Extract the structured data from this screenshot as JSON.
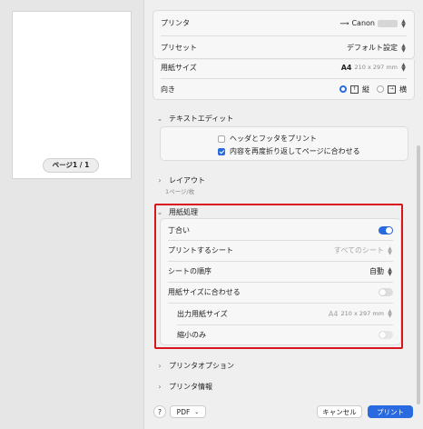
{
  "preview": {
    "page_indicator": "ページ1 / 1"
  },
  "printer": {
    "label": "プリンタ",
    "value": "Canon"
  },
  "preset": {
    "label": "プリセット",
    "value": "デフォルト設定"
  },
  "paper_size": {
    "label": "用紙サイズ",
    "value": "A4",
    "dims": "210 x 297 mm"
  },
  "orientation": {
    "label": "向き",
    "portrait": "縦",
    "landscape": "横",
    "selected": "portrait"
  },
  "textedit": {
    "title": "テキストエディット",
    "header_footer": {
      "label": "ヘッダとフッタをプリント",
      "checked": false
    },
    "rewrap": {
      "label": "内容を再度折り返してページに合わせる",
      "checked": true
    }
  },
  "layout": {
    "title": "レイアウト",
    "subtitle": "1ページ/枚"
  },
  "paper_handling": {
    "title": "用紙処理",
    "collate": {
      "label": "丁合い",
      "on": true
    },
    "pages_to_print": {
      "label": "プリントするシート",
      "value": "すべてのシート"
    },
    "page_order": {
      "label": "シートの順序",
      "value": "自動"
    },
    "scale_to_fit": {
      "label": "用紙サイズに合わせる",
      "on": false
    },
    "dest_paper": {
      "label": "出力用紙サイズ",
      "value": "A4",
      "dims": "210 x 297 mm"
    },
    "scale_down_only": {
      "label": "縮小のみ",
      "on": false
    }
  },
  "printer_options": {
    "title": "プリンタオプション"
  },
  "printer_info": {
    "title": "プリンタ情報"
  },
  "footer": {
    "help": "?",
    "pdf": "PDF",
    "cancel": "キャンセル",
    "print": "プリント"
  },
  "colors": {
    "accent": "#2a6ae0",
    "highlight": "#d9141c"
  }
}
